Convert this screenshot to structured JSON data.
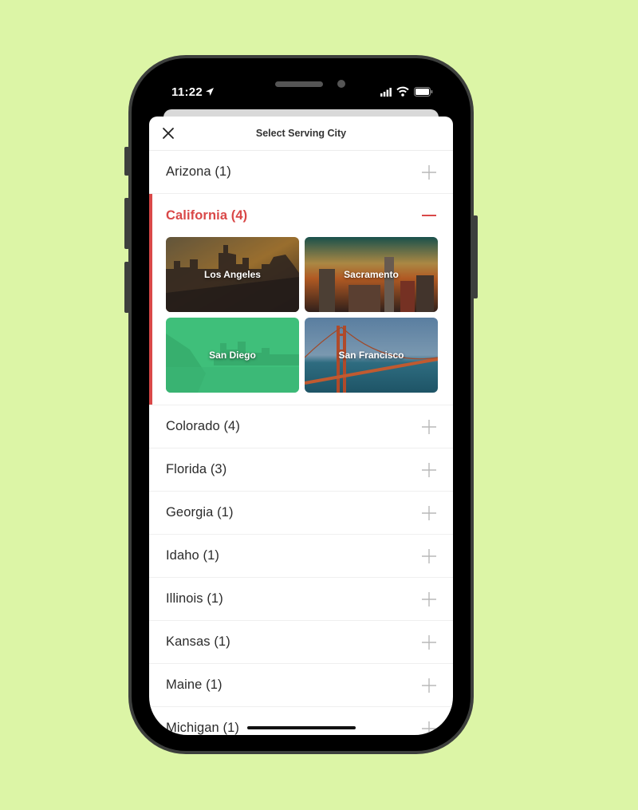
{
  "status_bar": {
    "time": "11:22"
  },
  "sheet": {
    "title": "Select Serving City",
    "close_icon": "close-icon"
  },
  "colors": {
    "accent": "#d94848",
    "background": "#dcf5a6"
  },
  "states": [
    {
      "label": "Arizona (1)",
      "expanded": false
    },
    {
      "label": "California (4)",
      "expanded": true,
      "cities": [
        {
          "name": "Los Angeles"
        },
        {
          "name": "Sacramento"
        },
        {
          "name": "San Diego"
        },
        {
          "name": "San Francisco"
        }
      ]
    },
    {
      "label": "Colorado (4)",
      "expanded": false
    },
    {
      "label": "Florida (3)",
      "expanded": false
    },
    {
      "label": "Georgia (1)",
      "expanded": false
    },
    {
      "label": "Idaho (1)",
      "expanded": false
    },
    {
      "label": "Illinois (1)",
      "expanded": false
    },
    {
      "label": "Kansas (1)",
      "expanded": false
    },
    {
      "label": "Maine (1)",
      "expanded": false
    },
    {
      "label": "Michigan (1)",
      "expanded": false
    }
  ]
}
